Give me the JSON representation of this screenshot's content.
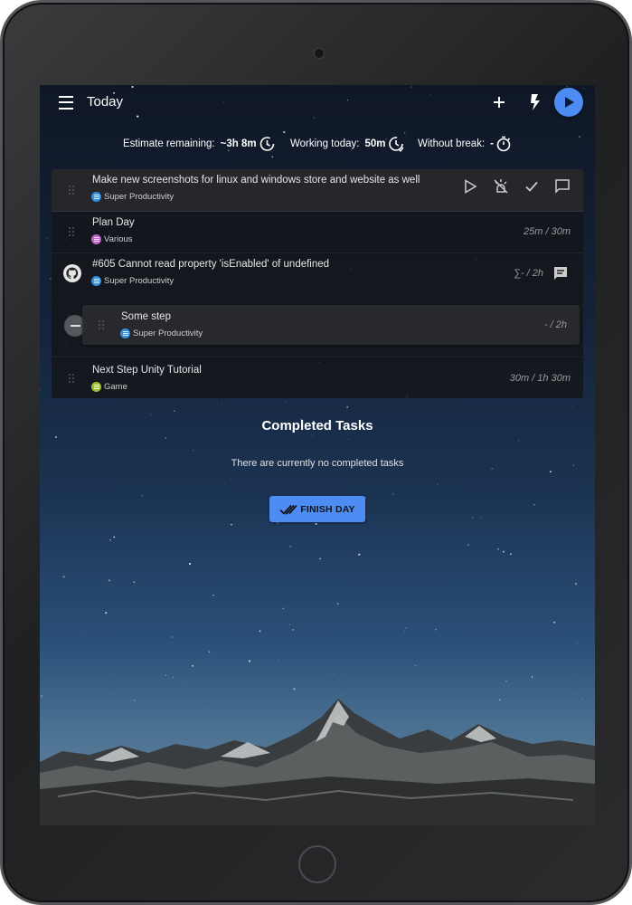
{
  "header": {
    "title": "Today",
    "icons": {
      "menu": "menu-icon",
      "add": "plus-icon",
      "quick": "flash-icon",
      "play": "play-icon"
    }
  },
  "stats": {
    "estimate_label": "Estimate remaining:",
    "estimate_value": "~3h 8m",
    "working_label": "Working today:",
    "working_value": "50m",
    "break_label": "Without break:",
    "break_value": "-"
  },
  "tasks": [
    {
      "title": "Make new screenshots for linux and windows store and website as well",
      "project": "Super Productivity",
      "project_color": "#2f8fe0",
      "time": "",
      "selected": true
    },
    {
      "title": "Plan Day",
      "project": "Various",
      "project_color": "#c061cb",
      "time": "25m / 30m"
    },
    {
      "title": "#605 Cannot read property 'isEnabled' of undefined",
      "project": "Super Productivity",
      "project_color": "#2f8fe0",
      "time": "∑- / 2h",
      "source_icon": "github-icon"
    },
    {
      "title": "Next Step Unity Tutorial",
      "project": "Game",
      "project_color": "#9bbf2a",
      "time": "30m / 1h 30m"
    }
  ],
  "subtask": {
    "title": "Some step",
    "project": "Super Productivity",
    "project_color": "#2f8fe0",
    "time": "- / 2h"
  },
  "task_actions": [
    "play-icon",
    "track-off-icon",
    "check-icon",
    "comment-icon"
  ],
  "completed": {
    "title": "Completed Tasks",
    "empty_text": "There are currently no completed tasks",
    "finish_label": "FINISH DAY"
  }
}
